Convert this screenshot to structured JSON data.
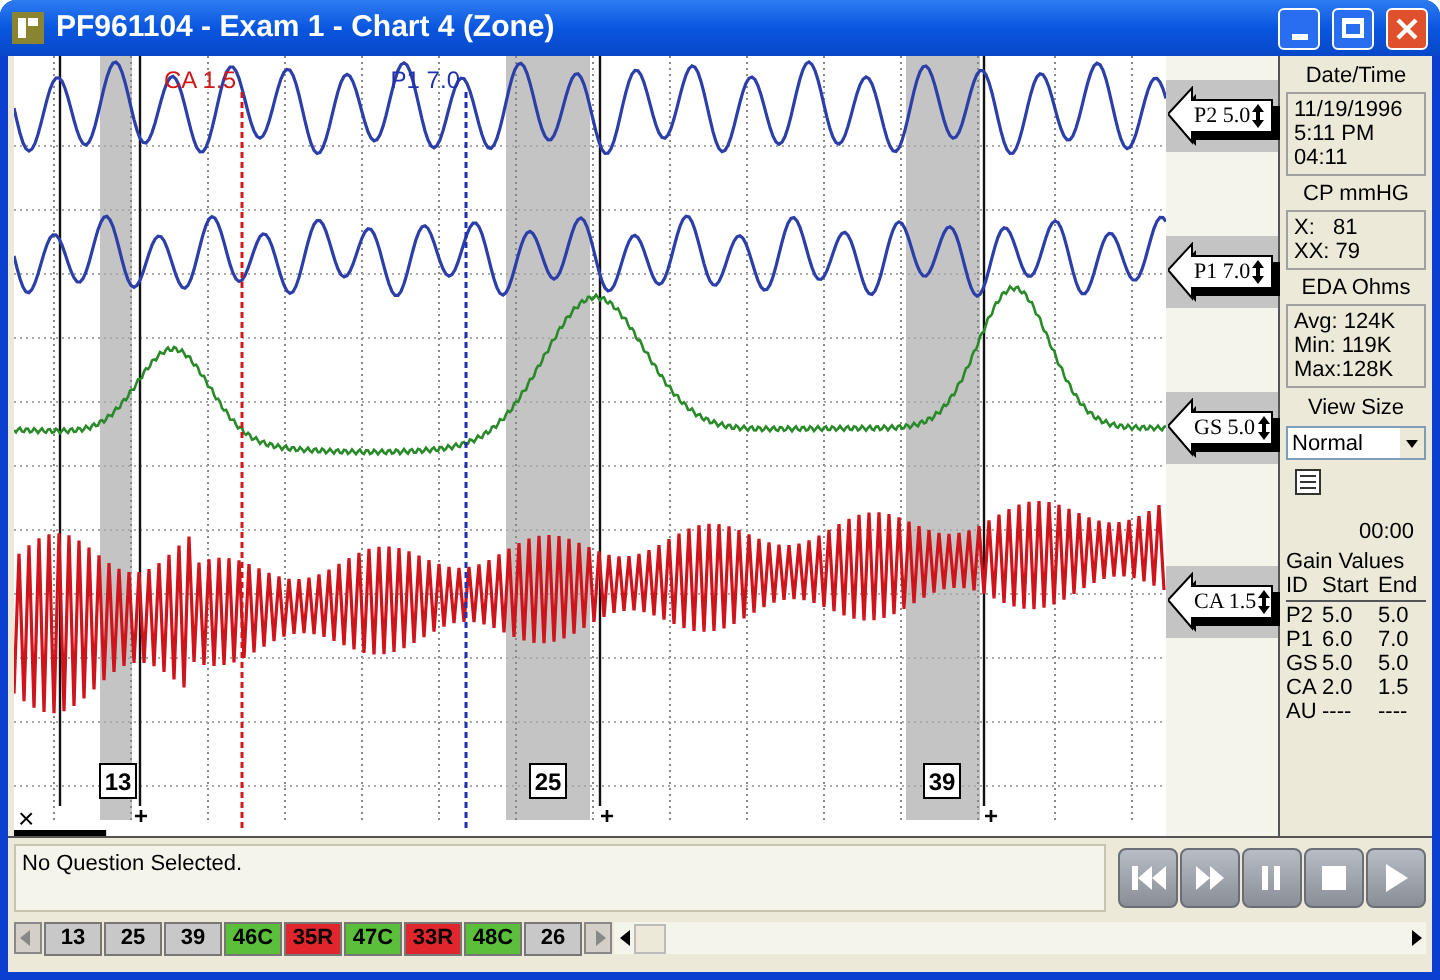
{
  "window": {
    "title": "PF961104 - Exam 1 - Chart 4 (Zone)"
  },
  "chart": {
    "markers": [
      {
        "label": "CA 1.5",
        "kind": "red"
      },
      {
        "label": "P1 7.0",
        "kind": "blue"
      }
    ],
    "questions": [
      "13",
      "25",
      "39"
    ],
    "plus_marks": [
      "+",
      "+",
      "+"
    ],
    "x_mark": "×",
    "progress": {
      "level": 0.08
    }
  },
  "channels": [
    {
      "label": "P2 5.0"
    },
    {
      "label": "P1 7.0"
    },
    {
      "label": "GS 5.0"
    },
    {
      "label": "CA 1.5"
    }
  ],
  "side_panel": {
    "sections": [
      {
        "title": "Date/Time",
        "lines": [
          "11/19/1996",
          "5:11 PM",
          "04:11"
        ]
      },
      {
        "title": "CP mmHG",
        "lines": [
          "X:   81",
          "XX: 79"
        ]
      },
      {
        "title": "EDA Ohms",
        "lines": [
          "Avg: 124K",
          "Min: 119K",
          "Max:128K"
        ]
      }
    ],
    "view_size": {
      "title": "View Size",
      "value": "Normal"
    },
    "timer": "00:00",
    "gain_values": {
      "title": "Gain Values",
      "columns": [
        "ID",
        "Start",
        "End"
      ],
      "rows": [
        [
          "P2",
          "5.0",
          "5.0"
        ],
        [
          "P1",
          "6.0",
          "7.0"
        ],
        [
          "GS",
          "5.0",
          "5.0"
        ],
        [
          "CA",
          "2.0",
          "1.5"
        ],
        [
          "AU",
          "----",
          "----"
        ]
      ]
    }
  },
  "status": {
    "message": "No Question Selected."
  },
  "question_tabs": [
    {
      "label": "13",
      "color": "#c8c8c8"
    },
    {
      "label": "25",
      "color": "#c8c8c8"
    },
    {
      "label": "39",
      "color": "#c8c8c8"
    },
    {
      "label": "46C",
      "color": "#5cbf3c"
    },
    {
      "label": "35R",
      "color": "#e0262c"
    },
    {
      "label": "47C",
      "color": "#5cbf3c"
    },
    {
      "label": "33R",
      "color": "#e0262c"
    },
    {
      "label": "48C",
      "color": "#5cbf3c"
    },
    {
      "label": "26",
      "color": "#c8c8c8"
    }
  ]
}
